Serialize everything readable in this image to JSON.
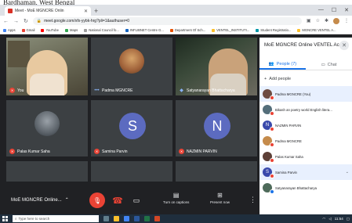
{
  "caption": "Bardhaman, West Bengal",
  "browser": {
    "tab_title": "Meet - MoE MGNCRE Onlin",
    "url": "meet.google.com/xfx-yybk-hrg?pli=1&authuser=0",
    "bookmarks": [
      "Apps",
      "Gmail",
      "YouTube",
      "Maps",
      "National Council fo...",
      "INFLIBNET Centre G...",
      "Department Of Sch...",
      "VENTEL_INSTITUTI...",
      "Student Registratio...",
      "MGNCRE VENTEL A..."
    ]
  },
  "tiles": [
    {
      "name": "You"
    },
    {
      "name": "Padma MGNCRE"
    },
    {
      "name": "Satyanarayan Bhattacharya"
    },
    {
      "name": "Palas Kumar Saha"
    },
    {
      "name": "Samina Parvin",
      "letter": "S"
    },
    {
      "name": "NAZMIN PARVIN",
      "letter": "N"
    }
  ],
  "controls": {
    "meeting_name": "MoE MGNCRE Online...",
    "captions_label": "Turn on captions",
    "present_label": "Present now"
  },
  "panel": {
    "title": "MoE MGNCRE Online VENTEL Ac...",
    "tab_people": "People (7)",
    "tab_chat": "Chat",
    "add_people": "Add people",
    "people": [
      {
        "name": "Padma MGNCRE (You)",
        "color": "#6d4c41"
      },
      {
        "name": "Bikash an poetry world English litera...",
        "color": "#546e7a"
      },
      {
        "name": "NAZMIN PARVIN",
        "letter": "N",
        "color": "#3949ab"
      },
      {
        "name": "Padma MGNCRE",
        "color": "#c58b4b"
      },
      {
        "name": "Palas Kumar Saha",
        "color": "#5d4037"
      },
      {
        "name": "Samina Parvin",
        "letter": "S",
        "color": "#3949ab"
      },
      {
        "name": "Satyanarayan Bhattacharya",
        "color": "#4e6a5a"
      }
    ]
  },
  "taskbar": {
    "search_placeholder": "Type here to search",
    "clock": "11:54"
  }
}
